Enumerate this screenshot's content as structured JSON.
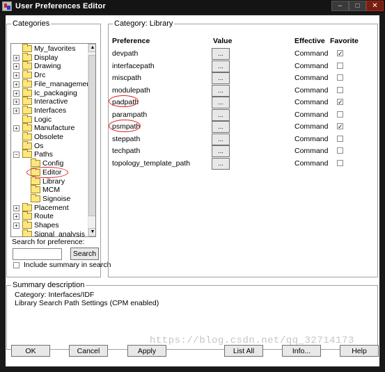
{
  "window": {
    "title": "User Preferences Editor",
    "controls": [
      "–",
      "□",
      "✕"
    ]
  },
  "categories": {
    "label": "Categories",
    "items": [
      {
        "label": "My_favorites",
        "exp": "",
        "level": 0
      },
      {
        "label": "Display",
        "exp": "+",
        "level": 0
      },
      {
        "label": "Drawing",
        "exp": "+",
        "level": 0
      },
      {
        "label": "Drc",
        "exp": "+",
        "level": 0
      },
      {
        "label": "File_management",
        "exp": "+",
        "level": 0
      },
      {
        "label": "Ic_packaging",
        "exp": "+",
        "level": 0
      },
      {
        "label": "Interactive",
        "exp": "+",
        "level": 0
      },
      {
        "label": "Interfaces",
        "exp": "+",
        "level": 0
      },
      {
        "label": "Logic",
        "exp": "",
        "level": 0
      },
      {
        "label": "Manufacture",
        "exp": "+",
        "level": 0
      },
      {
        "label": "Obsolete",
        "exp": "",
        "level": 0
      },
      {
        "label": "Os",
        "exp": "",
        "level": 0
      },
      {
        "label": "Paths",
        "exp": "−",
        "level": 0
      },
      {
        "label": "Config",
        "exp": "",
        "level": 1
      },
      {
        "label": "Editor",
        "exp": "",
        "level": 1
      },
      {
        "label": "Library",
        "exp": "",
        "level": 1
      },
      {
        "label": "MCM",
        "exp": "",
        "level": 1
      },
      {
        "label": "Signoise",
        "exp": "",
        "level": 1
      },
      {
        "label": "Placement",
        "exp": "+",
        "level": 0
      },
      {
        "label": "Route",
        "exp": "+",
        "level": 0
      },
      {
        "label": "Shapes",
        "exp": "+",
        "level": 0
      },
      {
        "label": "Signal_analysis",
        "exp": "",
        "level": 0
      }
    ]
  },
  "search": {
    "label": "Search for preference:",
    "value": "",
    "button": "Search",
    "include_summary_label": "Include summary in search",
    "include_summary_checked": false
  },
  "category_panel": {
    "label_prefix": "Category:",
    "label_value": "Library",
    "headers": {
      "preference": "Preference",
      "value": "Value",
      "effective": "Effective",
      "favorite": "Favorite"
    },
    "rows": [
      {
        "name": "devpath",
        "value_btn": "...",
        "effective": "Command",
        "favorite": true
      },
      {
        "name": "interfacepath",
        "value_btn": "...",
        "effective": "Command",
        "favorite": false
      },
      {
        "name": "miscpath",
        "value_btn": "...",
        "effective": "Command",
        "favorite": false
      },
      {
        "name": "modulepath",
        "value_btn": "...",
        "effective": "Command",
        "favorite": false
      },
      {
        "name": "padpath",
        "value_btn": "...",
        "effective": "Command",
        "favorite": true
      },
      {
        "name": "parampath",
        "value_btn": "...",
        "effective": "Command",
        "favorite": false
      },
      {
        "name": "psmpath",
        "value_btn": "...",
        "effective": "Command",
        "favorite": true
      },
      {
        "name": "steppath",
        "value_btn": "...",
        "effective": "Command",
        "favorite": false
      },
      {
        "name": "techpath",
        "value_btn": "...",
        "effective": "Command",
        "favorite": false
      },
      {
        "name": "topology_template_path",
        "value_btn": "...",
        "effective": "Command",
        "favorite": false
      }
    ]
  },
  "summary": {
    "label": "Summary description",
    "line1": "Category: Interfaces/IDF",
    "line2": "Library Search Path Settings (CPM enabled)"
  },
  "buttons": {
    "ok": "OK",
    "cancel": "Cancel",
    "apply": "Apply",
    "list_all": "List All",
    "info": "Info...",
    "help": "Help"
  },
  "watermark": "https://blog.csdn.net/qq_32714173",
  "colors": {
    "annotation": "#e02020",
    "titlebar": "#141414"
  }
}
